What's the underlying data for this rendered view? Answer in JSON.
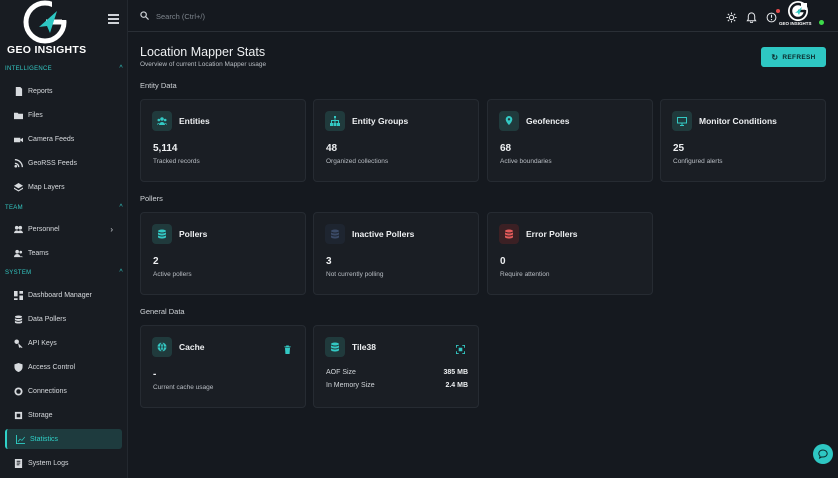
{
  "brand": {
    "name": "GEO INSIGHTS",
    "accent": "#2ec7c3"
  },
  "sidebar": {
    "sections": [
      {
        "title": "INTELLIGENCE",
        "items": [
          {
            "label": "Reports",
            "icon": "report-icon"
          },
          {
            "label": "Files",
            "icon": "folder-icon"
          },
          {
            "label": "Camera Feeds",
            "icon": "camera-icon"
          },
          {
            "label": "GeoRSS Feeds",
            "icon": "rss-icon"
          },
          {
            "label": "Map Layers",
            "icon": "layers-icon"
          }
        ]
      },
      {
        "title": "TEAM",
        "items": [
          {
            "label": "Personnel",
            "icon": "people-icon"
          },
          {
            "label": "Teams",
            "icon": "team-icon"
          }
        ]
      },
      {
        "title": "SYSTEM",
        "items": [
          {
            "label": "Dashboard Manager",
            "icon": "dashboard-icon"
          },
          {
            "label": "Data Pollers",
            "icon": "database-icon"
          },
          {
            "label": "API Keys",
            "icon": "key-icon"
          },
          {
            "label": "Access Control",
            "icon": "shield-icon"
          },
          {
            "label": "Connections",
            "icon": "connection-icon"
          },
          {
            "label": "Storage",
            "icon": "storage-icon"
          },
          {
            "label": "Statistics",
            "icon": "chart-line-icon",
            "active": true
          },
          {
            "label": "System Logs",
            "icon": "logs-icon"
          }
        ]
      }
    ]
  },
  "topbar": {
    "search_placeholder": "Search (Ctrl+/)",
    "avatar_label": "GEO INSIGHTS"
  },
  "page": {
    "title": "Location Mapper Stats",
    "subtitle": "Overview of current Location Mapper usage",
    "refresh_label": "REFRESH"
  },
  "groups": {
    "entity": {
      "label": "Entity Data",
      "cards": [
        {
          "title": "Entities",
          "value": "5,114",
          "desc": "Tracked records"
        },
        {
          "title": "Entity Groups",
          "value": "48",
          "desc": "Organized collections"
        },
        {
          "title": "Geofences",
          "value": "68",
          "desc": "Active boundaries"
        },
        {
          "title": "Monitor Conditions",
          "value": "25",
          "desc": "Configured alerts"
        }
      ]
    },
    "pollers": {
      "label": "Pollers",
      "cards": [
        {
          "title": "Pollers",
          "value": "2",
          "desc": "Active pollers"
        },
        {
          "title": "Inactive Pollers",
          "value": "3",
          "desc": "Not currently polling"
        },
        {
          "title": "Error Pollers",
          "value": "0",
          "desc": "Require attention"
        }
      ]
    },
    "general": {
      "label": "General Data",
      "cache": {
        "title": "Cache",
        "value": "-",
        "desc": "Current cache usage"
      },
      "tile38": {
        "title": "Tile38",
        "rows": [
          {
            "key": "AOF Size",
            "value": "385 MB"
          },
          {
            "key": "In Memory Size",
            "value": "2.4 MB"
          }
        ]
      }
    }
  }
}
